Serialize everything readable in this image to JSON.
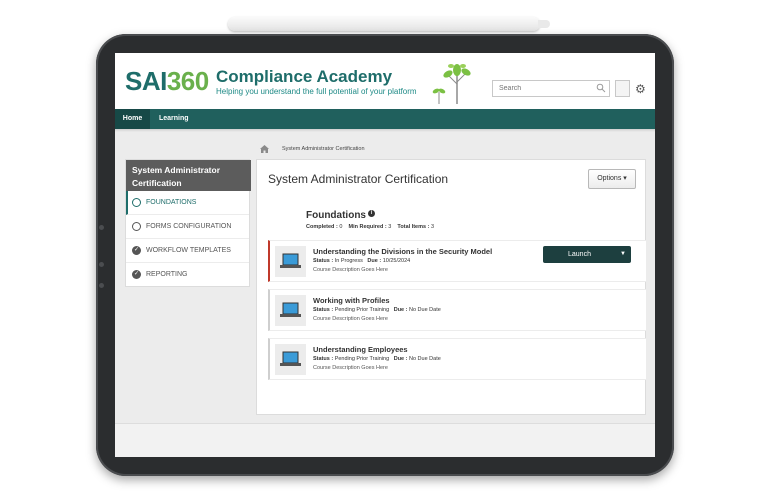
{
  "header": {
    "logo_main": "SAI",
    "logo_accent": "360",
    "title": "Compliance Academy",
    "subtitle": "Helping you understand the full potential of your platform",
    "search_placeholder": "Search"
  },
  "nav": {
    "items": [
      {
        "label": "Home"
      },
      {
        "label": "Learning"
      }
    ]
  },
  "breadcrumb": {
    "current": "System Administrator Certification"
  },
  "sidebar": {
    "title": "System Administrator Certification",
    "items": [
      {
        "label": "FOUNDATIONS",
        "state": "current"
      },
      {
        "label": "FORMS CONFIGURATION",
        "state": "incomplete"
      },
      {
        "label": "WORKFLOW TEMPLATES",
        "state": "complete"
      },
      {
        "label": "REPORTING",
        "state": "complete"
      }
    ]
  },
  "main": {
    "title": "System Administrator Certification",
    "options_label": "Options",
    "section": {
      "title": "Foundations",
      "completed_label": "Completed :",
      "completed": "0",
      "min_required_label": "Min Required :",
      "min_required": "3",
      "total_label": "Total Items :",
      "total": "3"
    },
    "courses": [
      {
        "title": "Understanding the Divisions in the Security Model",
        "status_label": "Status :",
        "status": "In Progress",
        "due_label": "Due :",
        "due": "10/25/2024",
        "description": "Course Description Goes Here",
        "action_label": "Launch"
      },
      {
        "title": "Working with Profiles",
        "status_label": "Status :",
        "status": "Pending Prior Training",
        "due_label": "Due :",
        "due": "No Due Date",
        "description": "Course Description Goes Here"
      },
      {
        "title": "Understanding Employees",
        "status_label": "Status :",
        "status": "Pending Prior Training",
        "due_label": "Due :",
        "due": "No Due Date",
        "description": "Course Description Goes Here"
      }
    ]
  },
  "colors": {
    "brand_teal": "#1e6d6a",
    "brand_green": "#6ab04c",
    "nav_bg": "#20605d",
    "launch_bg": "#1d3f3f",
    "current_marker": "#c0392b"
  }
}
